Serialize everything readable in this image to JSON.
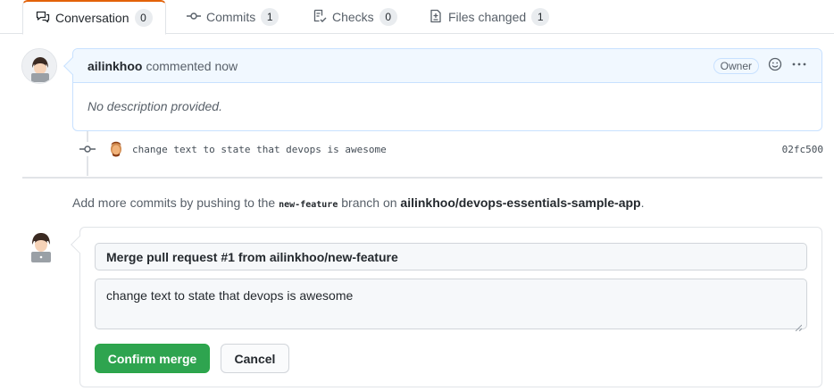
{
  "tabs": [
    {
      "label": "Conversation",
      "count": "0",
      "icon": "conversation-icon"
    },
    {
      "label": "Commits",
      "count": "1",
      "icon": "commit-icon"
    },
    {
      "label": "Checks",
      "count": "0",
      "icon": "checklist-icon"
    },
    {
      "label": "Files changed",
      "count": "1",
      "icon": "file-diff-icon"
    }
  ],
  "comment": {
    "author": "ailinkhoo",
    "action": "commented now",
    "badge": "Owner",
    "body": "No description provided."
  },
  "commit": {
    "message": "change text to state that devops is awesome",
    "sha": "02fc500"
  },
  "hint": {
    "prefix": "Add more commits by pushing to the",
    "branch": "new-feature",
    "middle": "branch on",
    "repo": "ailinkhoo/devops-essentials-sample-app",
    "suffix": "."
  },
  "merge": {
    "title": "Merge pull request #1 from ailinkhoo/new-feature",
    "message": "change text to state that devops is awesome",
    "confirm_label": "Confirm merge",
    "cancel_label": "Cancel"
  },
  "colors": {
    "accent_tab": "#e36209",
    "comment_header_bg": "#f1f8ff",
    "merge_button": "#2ea44f"
  }
}
